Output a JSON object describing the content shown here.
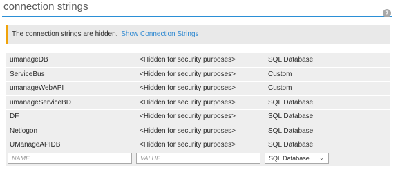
{
  "header": {
    "title": "connection strings",
    "help_icon": "question-icon",
    "help_glyph": "?"
  },
  "notice": {
    "text": "The connection strings are hidden.",
    "link": "Show Connection Strings",
    "accent": "#f0a30a"
  },
  "rows": [
    {
      "name": "umanageDB",
      "value": "<Hidden for security purposes>",
      "type": "SQL Database"
    },
    {
      "name": "ServiceBus",
      "value": "<Hidden for security purposes>",
      "type": "Custom"
    },
    {
      "name": "umanageWebAPI",
      "value": "<Hidden for security purposes>",
      "type": "Custom"
    },
    {
      "name": "umanageServiceBD",
      "value": "<Hidden for security purposes>",
      "type": "SQL Database"
    },
    {
      "name": "DF",
      "value": "<Hidden for security purposes>",
      "type": "SQL Database"
    },
    {
      "name": "Netlogon",
      "value": "<Hidden for security purposes>",
      "type": "SQL Database"
    },
    {
      "name": "UManageAPIDB",
      "value": "<Hidden for security purposes>",
      "type": "SQL Database"
    }
  ],
  "new_row": {
    "name_placeholder": "NAME",
    "value_placeholder": "VALUE",
    "type_selected": "SQL Database",
    "chevron_icon": "chevron-down-icon",
    "chevron_glyph": "⌄"
  }
}
